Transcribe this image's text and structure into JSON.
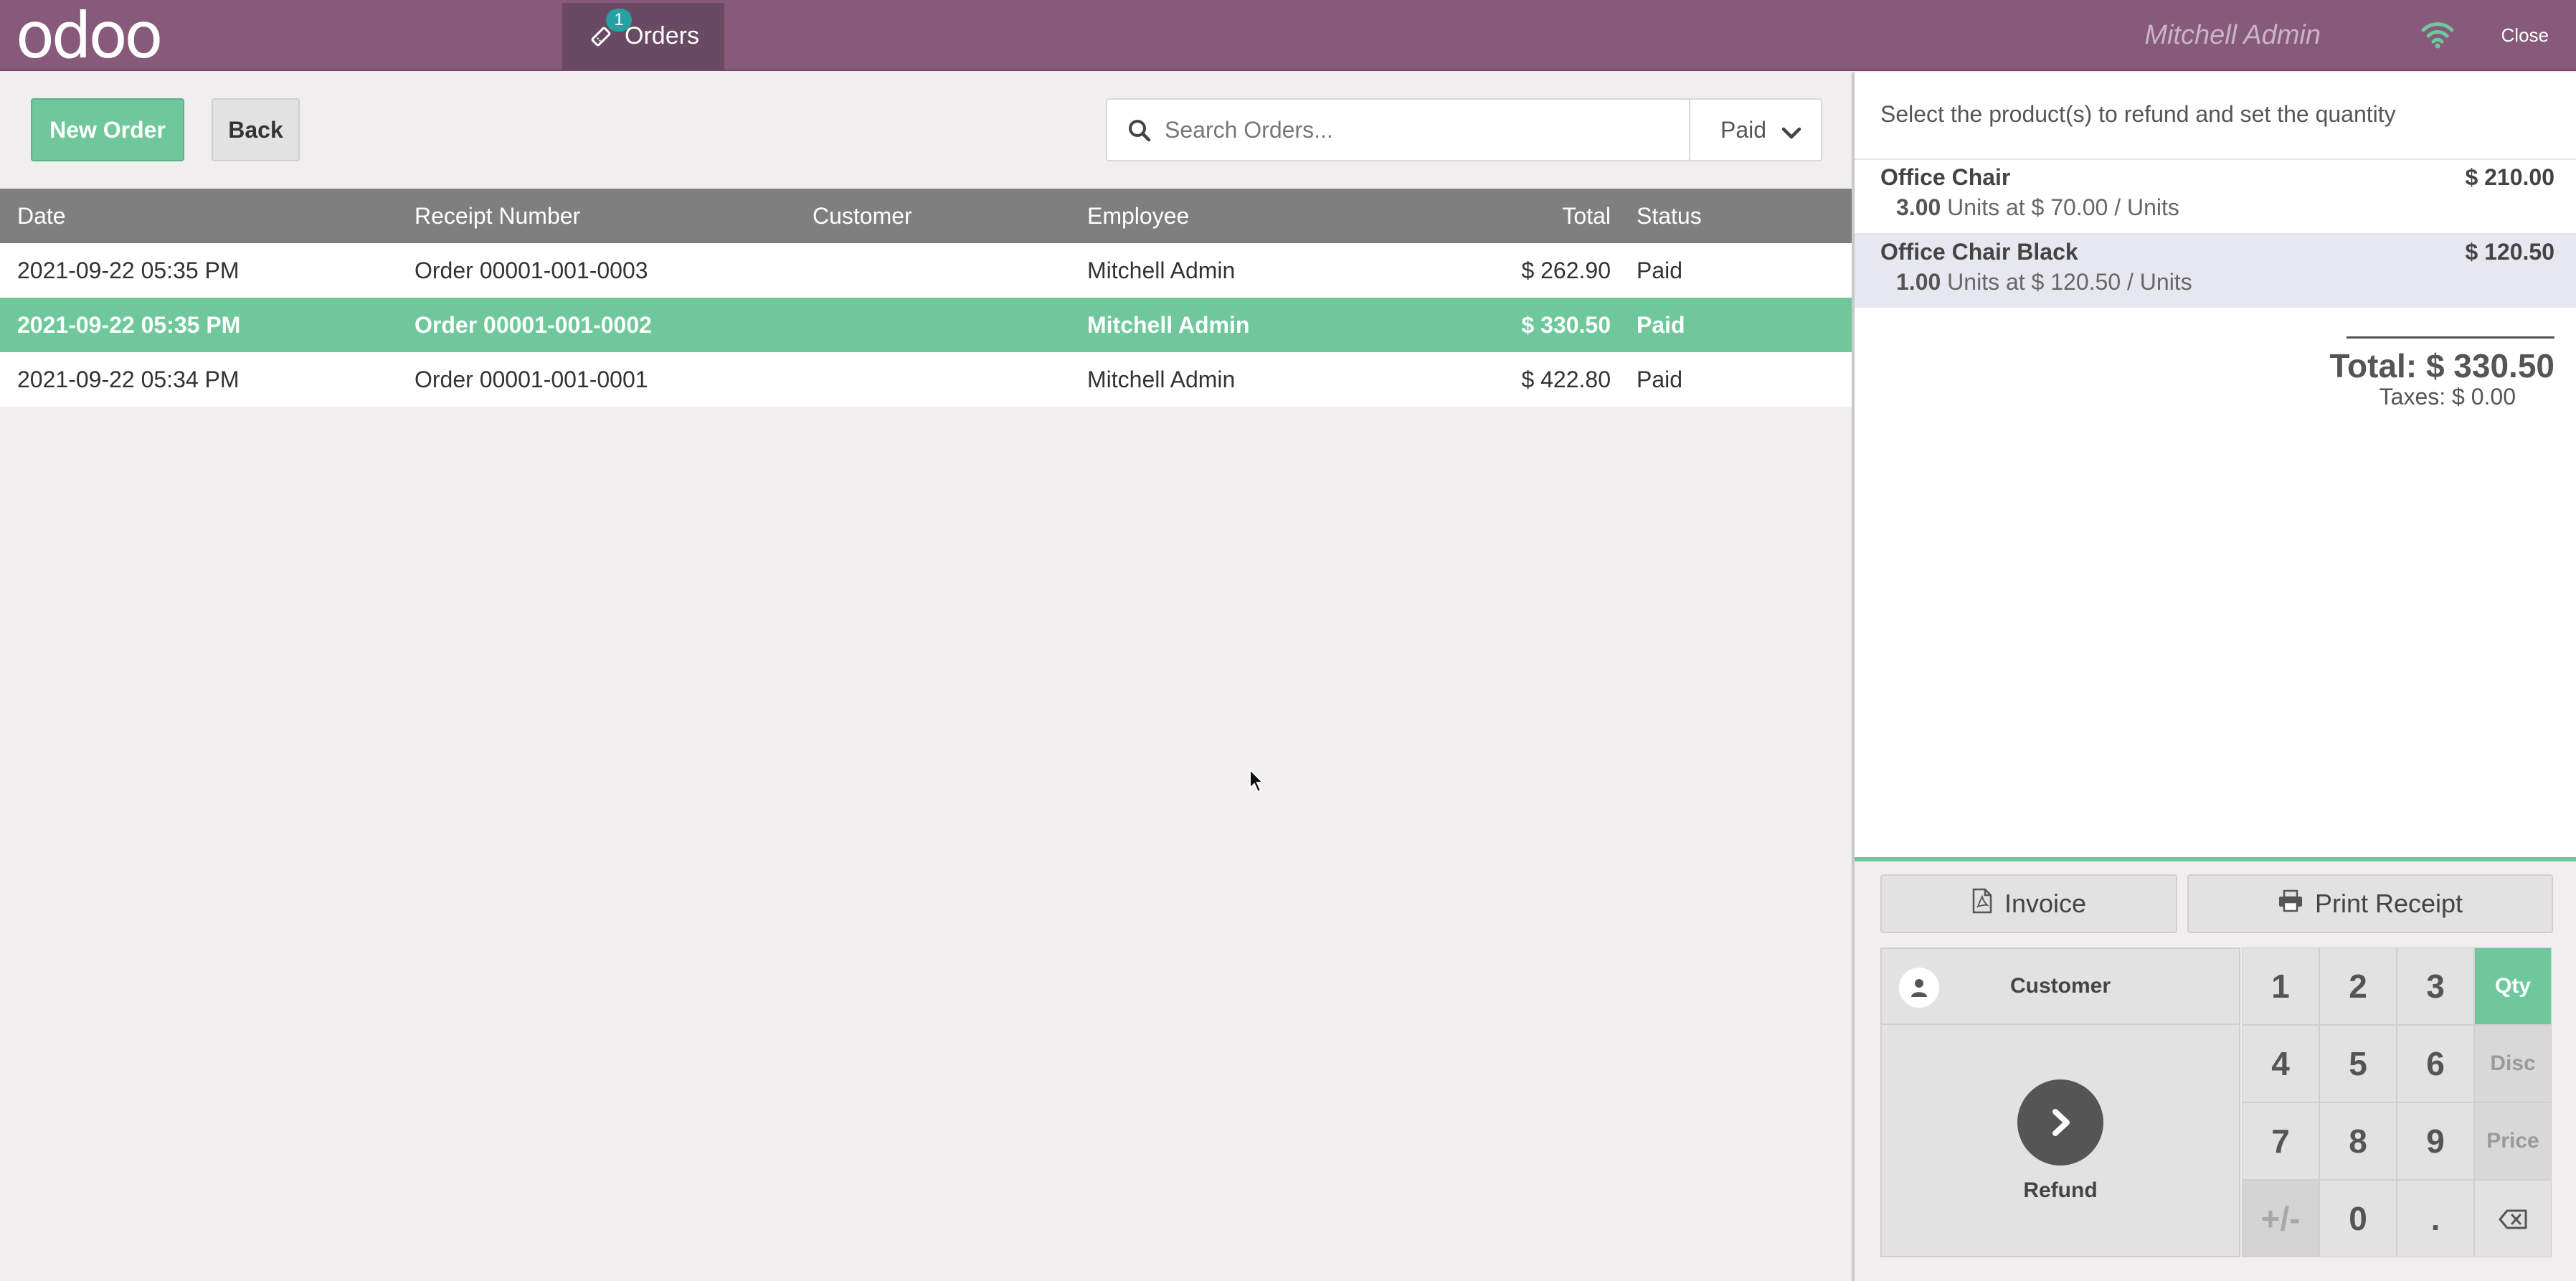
{
  "header": {
    "logo_text": "odoo",
    "orders_tab_label": "Orders",
    "orders_badge": "1",
    "user_name": "Mitchell Admin",
    "close_label": "Close"
  },
  "toolbar": {
    "new_order_label": "New Order",
    "back_label": "Back",
    "search_placeholder": "Search Orders...",
    "filter_value": "Paid"
  },
  "table": {
    "headers": {
      "date": "Date",
      "receipt": "Receipt Number",
      "customer": "Customer",
      "employee": "Employee",
      "total": "Total",
      "status": "Status"
    },
    "rows": [
      {
        "date": "2021-09-22 05:35 PM",
        "receipt": "Order 00001-001-0003",
        "customer": "",
        "employee": "Mitchell Admin",
        "total": "$ 262.90",
        "status": "Paid"
      },
      {
        "date": "2021-09-22 05:35 PM",
        "receipt": "Order 00001-001-0002",
        "customer": "",
        "employee": "Mitchell Admin",
        "total": "$ 330.50",
        "status": "Paid"
      },
      {
        "date": "2021-09-22 05:34 PM",
        "receipt": "Order 00001-001-0001",
        "customer": "",
        "employee": "Mitchell Admin",
        "total": "$ 422.80",
        "status": "Paid"
      }
    ],
    "selected_index": 1
  },
  "refund_panel": {
    "instruction": "Select the product(s) to refund and set the quantity",
    "lines": [
      {
        "name": "Office Chair",
        "price": "$ 210.00",
        "qty": "3.00",
        "info": "Units at $ 70.00 / Units"
      },
      {
        "name": "Office Chair Black",
        "price": "$ 120.50",
        "qty": "1.00",
        "info": "Units at $ 120.50 / Units"
      }
    ],
    "total": "Total: $ 330.50",
    "taxes": "Taxes: $ 0.00"
  },
  "controls": {
    "invoice_label": "Invoice",
    "print_receipt_label": "Print Receipt",
    "customer_label": "Customer",
    "refund_label": "Refund",
    "keys": {
      "k1": "1",
      "k2": "2",
      "k3": "3",
      "k4": "4",
      "k5": "5",
      "k6": "6",
      "k7": "7",
      "k8": "8",
      "k9": "9",
      "sign": "+/-",
      "k0": "0",
      "dot": "."
    },
    "modes": {
      "qty": "Qty",
      "disc": "Disc",
      "price": "Price"
    },
    "active_mode": "Qty"
  },
  "colors": {
    "brand": "#875a7b",
    "accent": "#6ec89b",
    "badge": "#25a0a3",
    "wifi": "#6ec89b"
  }
}
